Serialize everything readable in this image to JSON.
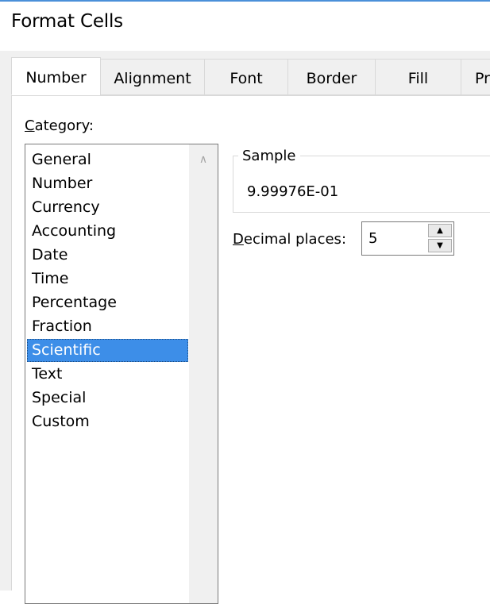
{
  "window": {
    "title": "Format Cells"
  },
  "tabs": [
    {
      "label": "Number",
      "active": true
    },
    {
      "label": "Alignment",
      "active": false
    },
    {
      "label": "Font",
      "active": false
    },
    {
      "label": "Border",
      "active": false
    },
    {
      "label": "Fill",
      "active": false
    },
    {
      "label": "Pr",
      "active": false
    }
  ],
  "category": {
    "label_accel": "C",
    "label_rest": "ategory:",
    "items": [
      "General",
      "Number",
      "Currency",
      "Accounting",
      "Date",
      "Time",
      "Percentage",
      "Fraction",
      "Scientific",
      "Text",
      "Special",
      "Custom"
    ],
    "selected": "Scientific"
  },
  "sample": {
    "legend": "Sample",
    "value": "9.99976E-01"
  },
  "decimal_places": {
    "label_accel": "D",
    "label_rest": "ecimal places:",
    "value": "5"
  },
  "colors": {
    "selection": "#3d8ee8",
    "panel": "#f0f0f0"
  },
  "icons": {
    "spin_up": "spin-up-icon",
    "spin_down": "spin-down-icon",
    "scroll_up": "scroll-up-icon"
  }
}
